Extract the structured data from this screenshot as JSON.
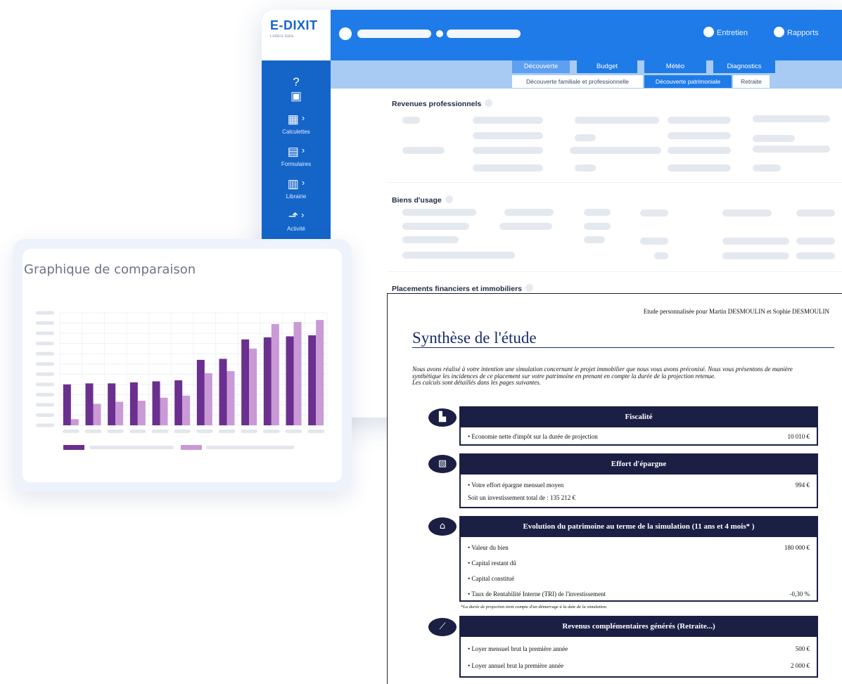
{
  "app": {
    "logo_title": "E-DIXIT",
    "logo_subtitle": "Lettera Italia",
    "sidebar": {
      "items": [
        {
          "icon": "calculator-icon",
          "label": "Calculettes"
        },
        {
          "icon": "form-icon",
          "label": "Formulaires"
        },
        {
          "icon": "library-icon",
          "label": "Librairie"
        },
        {
          "icon": "activity-icon",
          "label": "Activité"
        }
      ]
    },
    "top_links": [
      "Entretien",
      "Rapports"
    ],
    "tabs": [
      "Découverte",
      "Budget",
      "Météo",
      "Diagnostics"
    ],
    "subtabs": [
      "Découverte familiale et professionnelle",
      "Découverte patrimoniale",
      "Retraite"
    ],
    "sections": [
      "Revenues professionnels",
      "Biens d'usage",
      "Placements financiers et immobiliers"
    ]
  },
  "comparison": {
    "title": "Graphique de comparaison",
    "chart_data": {
      "type": "bar",
      "series": [
        {
          "color": "#6a2f8f",
          "values": [
            40,
            41,
            41,
            42,
            43,
            44,
            64,
            65,
            84,
            86,
            87,
            88
          ]
        },
        {
          "color": "#c99ad6",
          "values": [
            6,
            21,
            23,
            24,
            27,
            29,
            51,
            53,
            75,
            99,
            101,
            103
          ]
        }
      ],
      "ylim": [
        0,
        110
      ],
      "grid": true
    }
  },
  "doc": {
    "header": "Etude personnalisée pour Martin DESMOULIN et Sophie DESMOULIN",
    "title": "Synthèse de l'étude",
    "intro1": "Nous avons réalisé à votre intention une simulation concernant le projet immobilier que nous vous avons préconisé. Nous vous présentons de manière synthétique les incidences de ce placement sur votre patrimoine en prenant en compte la durée de la projection retenue.",
    "intro2": "Les calculs sont détaillés dans les pages suivantes.",
    "fiscalite": {
      "title": "Fiscalité",
      "rows": [
        {
          "label": "• Economie nette d'impôt sur la durée de projection",
          "value": "10 010 €"
        }
      ]
    },
    "effort": {
      "title": "Effort d'épargne",
      "rows": [
        {
          "label": "• Votre effort épargne mensuel moyen",
          "value": "994 €"
        },
        {
          "label": "Soit un investissement total de : 135 212 €",
          "value": ""
        }
      ]
    },
    "evolution": {
      "title": "Evolution du patrimoine au terme de la simulation (11 ans et 4 mois* )",
      "rows": [
        {
          "label": "• Valeur du bien",
          "value": "180 000 €"
        },
        {
          "label": "• Capital restant dû",
          "value": ""
        },
        {
          "label": "• Capital constitué",
          "value": ""
        },
        {
          "label": "• Taux de Rentabilité Interne (TRI) de l'investissement",
          "value": "-0,30 %"
        }
      ],
      "footnote": "*La durée de projection tient compte d'un démarrage à la date de la simulation."
    },
    "revenus": {
      "title": "Revenus complémentaires générés (Retraite...)",
      "rows": [
        {
          "label": "• Loyer mensuel brut la première année",
          "value": "500 €"
        },
        {
          "label": "• Loyer annuel brut la première année",
          "value": "2 000 €"
        }
      ]
    }
  }
}
